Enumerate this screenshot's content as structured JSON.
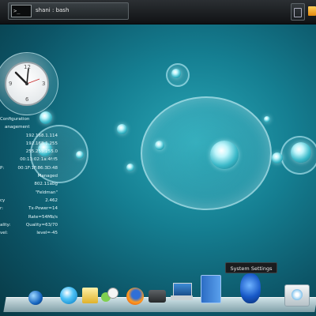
{
  "top_panel": {
    "terminal_icon_text": ">_",
    "task_label": "shani : bash"
  },
  "clock": {
    "numbers": {
      "n12": "12",
      "n3": "3",
      "n6": "6",
      "n9": "9"
    }
  },
  "network_info": {
    "heading": "Configuration",
    "subheading": "anagement",
    "rows": [
      {
        "key": "",
        "value": "192.168.1.114"
      },
      {
        "key": "",
        "value": "192.168.1.255"
      },
      {
        "key": "",
        "value": "255.255.255.0"
      },
      {
        "key": "",
        "value": "00:13:02:1a:4f:f5"
      },
      {
        "key": "P:",
        "value": "00:1F:1F:86:3D:48"
      },
      {
        "key": "",
        "value": "Managed"
      },
      {
        "key": "",
        "value": "802.11abg"
      },
      {
        "key": "",
        "value": "\"Feldman\""
      },
      {
        "key": "cy",
        "value": "2.462"
      },
      {
        "key": "r:",
        "value": "Tx-Power=14"
      },
      {
        "key": "",
        "value": "Rate=54Mb/s"
      },
      {
        "key": "ality:",
        "value": "Quality=63/70"
      },
      {
        "key": "vel:",
        "value": "level=-45"
      }
    ]
  },
  "tooltip": {
    "text": "System Settings"
  },
  "dock": {
    "items": [
      {
        "icon": "globe-icon"
      },
      {
        "icon": "blue-orb-icon"
      },
      {
        "icon": "folder-icon"
      },
      {
        "icon": "chat-icon"
      },
      {
        "icon": "firefox-icon"
      },
      {
        "icon": "media-player-icon"
      },
      {
        "icon": "laptop-icon"
      },
      {
        "icon": "book-icon"
      },
      {
        "icon": "system-settings-icon"
      },
      {
        "icon": "disk-icon"
      }
    ]
  },
  "colors": {
    "desktop_center": "#2aa7b6",
    "desktop_edge": "#083945",
    "panel": "#101214",
    "tooltip_bg": "#1a1c1e"
  }
}
